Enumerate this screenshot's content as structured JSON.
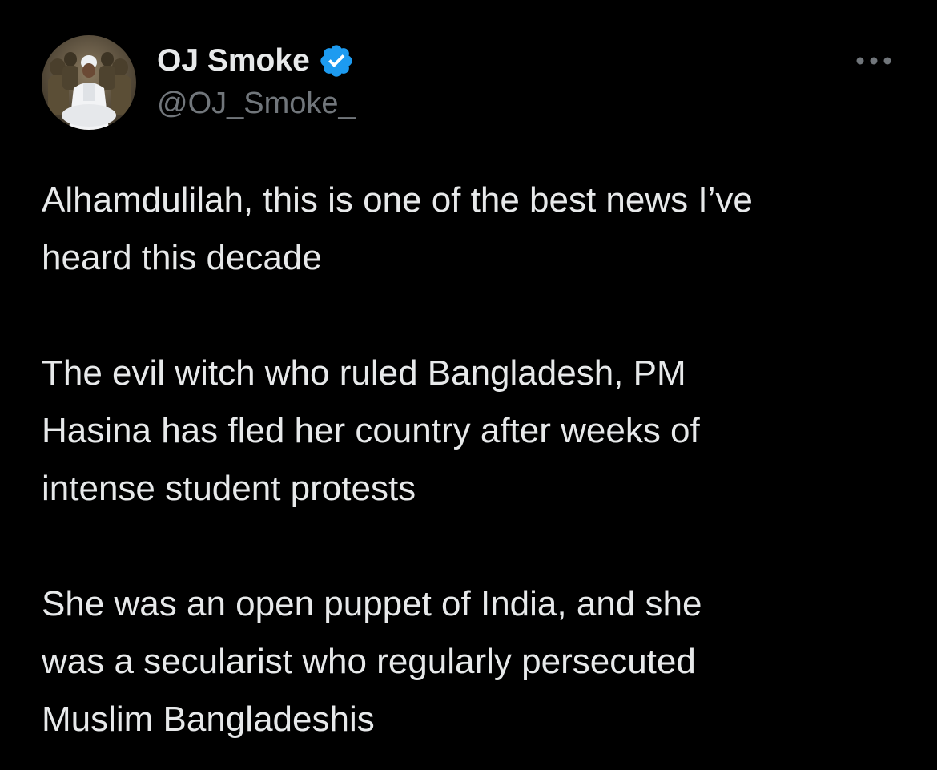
{
  "post": {
    "author": {
      "display_name": "OJ Smoke",
      "handle": "@OJ_Smoke_",
      "verified_icon": "verified-badge-icon",
      "verified_color": "#1d9bf0"
    },
    "more_icon": "more-options-icon",
    "paragraphs": [
      {
        "lines": [
          "Alhamdulilah, this is one of the best news I’ve",
          "heard this decade"
        ]
      },
      {
        "lines": [
          "The evil witch who ruled Bangladesh, PM",
          "Hasina has fled her country after weeks of",
          "intense student protests"
        ]
      },
      {
        "lines": [
          "She was an open puppet of India, and she",
          "was a secularist who regularly persecuted",
          "Muslim Bangladeshis"
        ]
      }
    ]
  },
  "theme": {
    "background": "#000000",
    "text_primary": "#e7e9ea",
    "text_secondary": "#71767b"
  }
}
